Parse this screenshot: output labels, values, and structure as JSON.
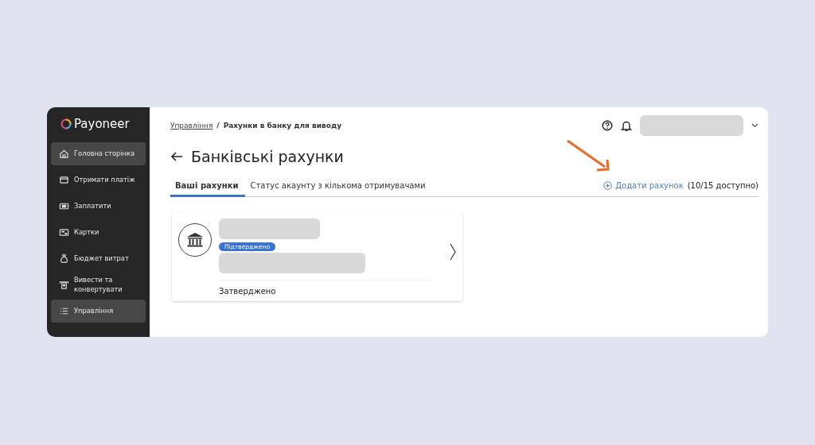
{
  "sidebar": {
    "logo": "Payoneer",
    "items": [
      {
        "label": "Головна сторінка",
        "selected": true
      },
      {
        "label": "Отримати платіж",
        "selected": false
      },
      {
        "label": "Заплатити",
        "selected": false
      },
      {
        "label": "Картки",
        "selected": false
      },
      {
        "label": "Бюджет витрат",
        "selected": false
      },
      {
        "label": "Вивести та конвертувати",
        "selected": false
      },
      {
        "label": "Управління",
        "selected": true
      }
    ]
  },
  "breadcrumb": [
    {
      "label": "Управління",
      "kind": "link"
    },
    {
      "label": "/",
      "kind": "separator"
    },
    {
      "label": "Рахунки в банку для виводу",
      "kind": "current"
    }
  ],
  "title": "Банківські рахунки",
  "tabs": [
    {
      "label": "Ваші рахунки",
      "selected": true
    },
    {
      "label": "Статус акаунту з кількома отримувачами",
      "selected": false
    }
  ],
  "add_account": {
    "label": "Додати рахунок",
    "note": "(10/15 доступно)"
  },
  "account_card": {
    "badge": "Підтверджено",
    "status": "Затверджено"
  }
}
